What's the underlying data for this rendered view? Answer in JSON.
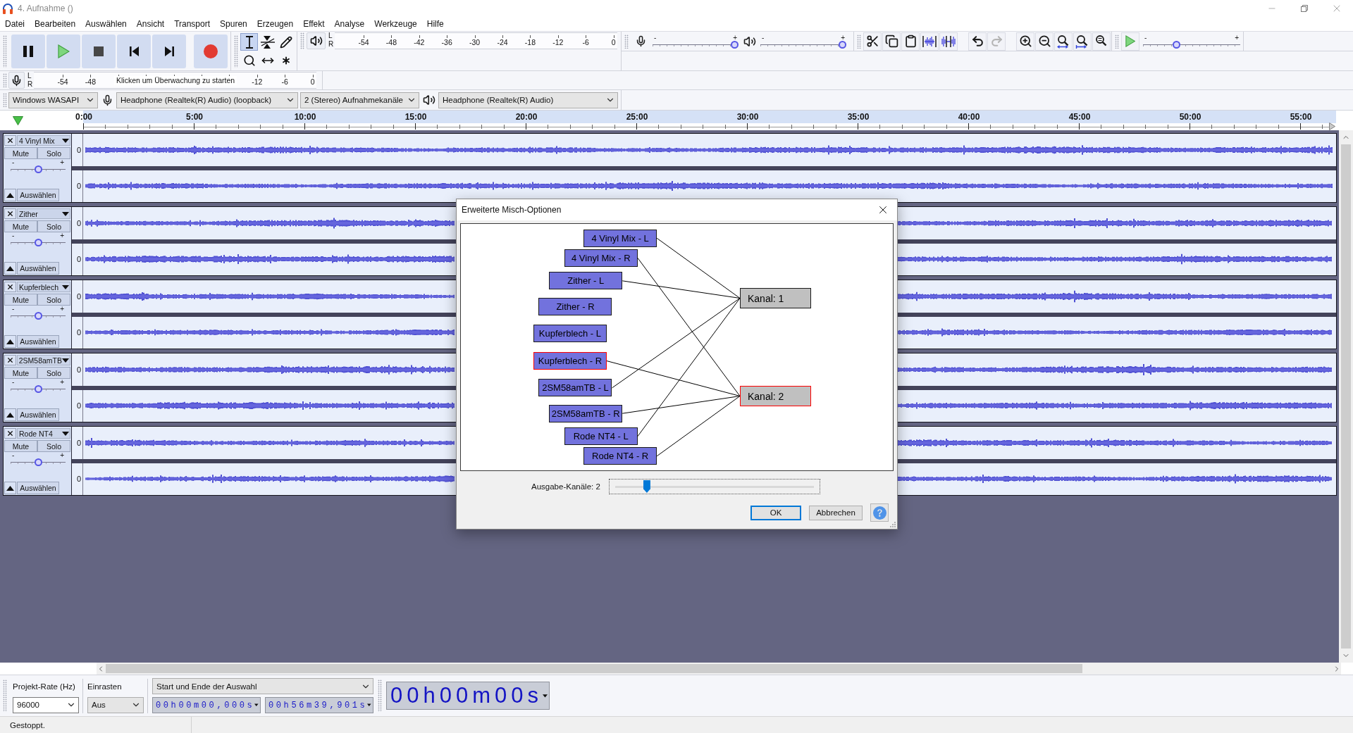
{
  "window": {
    "title": "4. Aufnahme ()"
  },
  "menu": [
    "Datei",
    "Bearbeiten",
    "Auswählen",
    "Ansicht",
    "Transport",
    "Spuren",
    "Erzeugen",
    "Effekt",
    "Analyse",
    "Werkzeuge",
    "Hilfe"
  ],
  "tools": [
    {
      "kind": "select",
      "selected": true
    },
    {
      "kind": "envelope",
      "selected": false
    },
    {
      "kind": "draw",
      "selected": false
    },
    {
      "kind": "zoom",
      "selected": false
    },
    {
      "kind": "timeshift",
      "selected": false
    },
    {
      "kind": "multi",
      "selected": false
    }
  ],
  "playback_meter": {
    "channels": [
      "L",
      "R"
    ],
    "scale": [
      "-54",
      "-48",
      "-42",
      "-36",
      "-30",
      "-24",
      "-18",
      "-12",
      "-6",
      "0"
    ]
  },
  "mixer": {
    "recording": {
      "min": "-",
      "max": "+",
      "level": 1
    },
    "playback": {
      "min": "-",
      "max": "+",
      "level": 1
    }
  },
  "edit_groups": [
    {
      "buttons": [
        {
          "kind": "cut",
          "disabled": false
        },
        {
          "kind": "copy",
          "disabled": false
        },
        {
          "kind": "paste",
          "disabled": false
        },
        {
          "kind": "trim",
          "disabled": false
        },
        {
          "kind": "silence",
          "disabled": false
        }
      ]
    },
    {
      "buttons": [
        {
          "kind": "undo",
          "disabled": false
        },
        {
          "kind": "redo",
          "disabled": true
        }
      ]
    },
    {
      "buttons": [
        {
          "kind": "zoom_in",
          "disabled": false
        },
        {
          "kind": "zoom_out",
          "disabled": false
        },
        {
          "kind": "fit_selection",
          "disabled": false
        },
        {
          "kind": "fit_project",
          "disabled": false
        },
        {
          "kind": "zoom_toggle",
          "disabled": false
        }
      ]
    }
  ],
  "play_at_speed": {
    "min": "-",
    "max": "+",
    "level": 0.33
  },
  "recording_meter": {
    "channels": [
      "L",
      "R"
    ],
    "scale_start": [
      "-54",
      "-48"
    ],
    "hint": "Klicken um Überwachung zu starten",
    "scale_end": [
      "-12",
      "-6",
      "0"
    ]
  },
  "devices": {
    "host": "Windows WASAPI",
    "input": "Headphone (Realtek(R) Audio) (loopback)",
    "input_channels": "2 (Stereo) Aufnahmekanäle",
    "output": "Headphone (Realtek(R) Audio)"
  },
  "ruler": {
    "labels": [
      "0:00",
      "5:00",
      "10:00",
      "15:00",
      "20:00",
      "25:00",
      "30:00",
      "35:00",
      "40:00",
      "45:00",
      "50:00",
      "55:00"
    ]
  },
  "tracks": [
    {
      "name": "4 Vinyl Mix",
      "mute": "Mute",
      "solo": "Solo",
      "gain": {
        "min": "-",
        "max": "+",
        "level": 0.5
      },
      "select": "Auswählen",
      "channels": [
        {
          "scale": "0"
        },
        {
          "scale": "0"
        }
      ]
    },
    {
      "name": "Zither",
      "mute": "Mute",
      "solo": "Solo",
      "gain": {
        "min": "-",
        "max": "+",
        "level": 0.5
      },
      "select": "Auswählen",
      "channels": [
        {
          "scale": "0"
        },
        {
          "scale": "0"
        }
      ]
    },
    {
      "name": "Kupferblech",
      "mute": "Mute",
      "solo": "Solo",
      "gain": {
        "min": "-",
        "max": "+",
        "level": 0.5
      },
      "select": "Auswählen",
      "channels": [
        {
          "scale": "0"
        },
        {
          "scale": "0"
        }
      ]
    },
    {
      "name": "2SM58amTB",
      "mute": "Mute",
      "solo": "Solo",
      "gain": {
        "min": "-",
        "max": "+",
        "level": 0.5
      },
      "select": "Auswählen",
      "channels": [
        {
          "scale": "0"
        },
        {
          "scale": "0"
        }
      ]
    },
    {
      "name": "Rode NT4",
      "mute": "Mute",
      "solo": "Solo",
      "gain": {
        "min": "-",
        "max": "+",
        "level": 0.5
      },
      "select": "Auswählen",
      "channels": [
        {
          "scale": "0"
        },
        {
          "scale": "0"
        }
      ]
    }
  ],
  "dialog": {
    "title": "Erweiterte Misch-Optionen",
    "inputs": [
      {
        "label": "4 Vinyl Mix - L",
        "selected": false,
        "routes": [
          true,
          false
        ]
      },
      {
        "label": "4 Vinyl Mix - R",
        "selected": false,
        "routes": [
          false,
          true
        ]
      },
      {
        "label": "Zither - L",
        "selected": false,
        "routes": [
          true,
          false
        ]
      },
      {
        "label": "Zither - R",
        "selected": false,
        "routes": [
          false,
          false
        ]
      },
      {
        "label": "Kupferblech - L",
        "selected": false,
        "routes": [
          false,
          false
        ]
      },
      {
        "label": "Kupferblech - R",
        "selected": true,
        "routes": [
          false,
          true
        ]
      },
      {
        "label": "2SM58amTB - L",
        "selected": false,
        "routes": [
          true,
          false
        ]
      },
      {
        "label": "2SM58amTB - R",
        "selected": false,
        "routes": [
          false,
          true
        ]
      },
      {
        "label": "Rode NT4 - L",
        "selected": false,
        "routes": [
          true,
          false
        ]
      },
      {
        "label": "Rode NT4 - R",
        "selected": false,
        "routes": [
          false,
          true
        ]
      }
    ],
    "outputs": [
      {
        "label": "Kanal: 1",
        "selected": false
      },
      {
        "label": "Kanal: 2",
        "selected": true
      }
    ],
    "output_channels": {
      "label": "Ausgabe-Kanäle: 2",
      "level": 0.16
    },
    "buttons": [
      {
        "label": "OK",
        "kind": "default"
      },
      {
        "label": "Abbrechen",
        "kind": "normal"
      }
    ]
  },
  "selection_bar": {
    "rate_label": "Projekt-Rate (Hz)",
    "rate": "96000",
    "snap_label": "Einrasten",
    "snap": "Aus",
    "mode": "Start und Ende der Auswahl",
    "start": "00h00m00,000s",
    "end": "00h56m39,901s",
    "position": "00h00m00s"
  },
  "status_bar": {
    "text": "Gestoppt."
  }
}
